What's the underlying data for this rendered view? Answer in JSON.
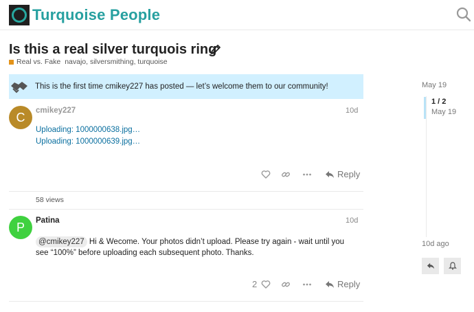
{
  "site": {
    "title": "Turquoise People",
    "accent": "#27a0a0"
  },
  "topic": {
    "title": "Is this a real silver turquois ring",
    "category": "Real vs. Fake",
    "category_color": "#e3931a",
    "tags": "navajo, silversmithing, turquoise"
  },
  "notice": {
    "text": "This is the first time cmikey227 has posted — let’s welcome them to our community!"
  },
  "posts": [
    {
      "username": "cmikey227",
      "avatar_letter": "C",
      "avatar_color": "#b98a28",
      "date": "10d",
      "links": [
        "Uploading: 1000000638.jpg…",
        "Uploading: 1000000639.jpg…"
      ],
      "reply_label": "Reply",
      "views": "58 views"
    },
    {
      "username": "Patina",
      "avatar_letter": "P",
      "avatar_color": "#3fd13f",
      "date": "10d",
      "mention": "@cmikey227",
      "body": " Hi & Wecome. Your photos didn’t upload. Please try again - wait until you see “100%” before uploading each subsequent photo. Thanks.",
      "like_count": "2",
      "reply_label": "Reply"
    }
  ],
  "timeline": {
    "start_date": "May 19",
    "position": "1 / 2",
    "current_date": "May 19",
    "end_label": "10d ago"
  },
  "icons": [
    "search-icon",
    "pencil-icon",
    "handshake-icon",
    "heart-icon",
    "link-icon",
    "ellipsis-icon",
    "reply-icon",
    "bell-icon"
  ]
}
